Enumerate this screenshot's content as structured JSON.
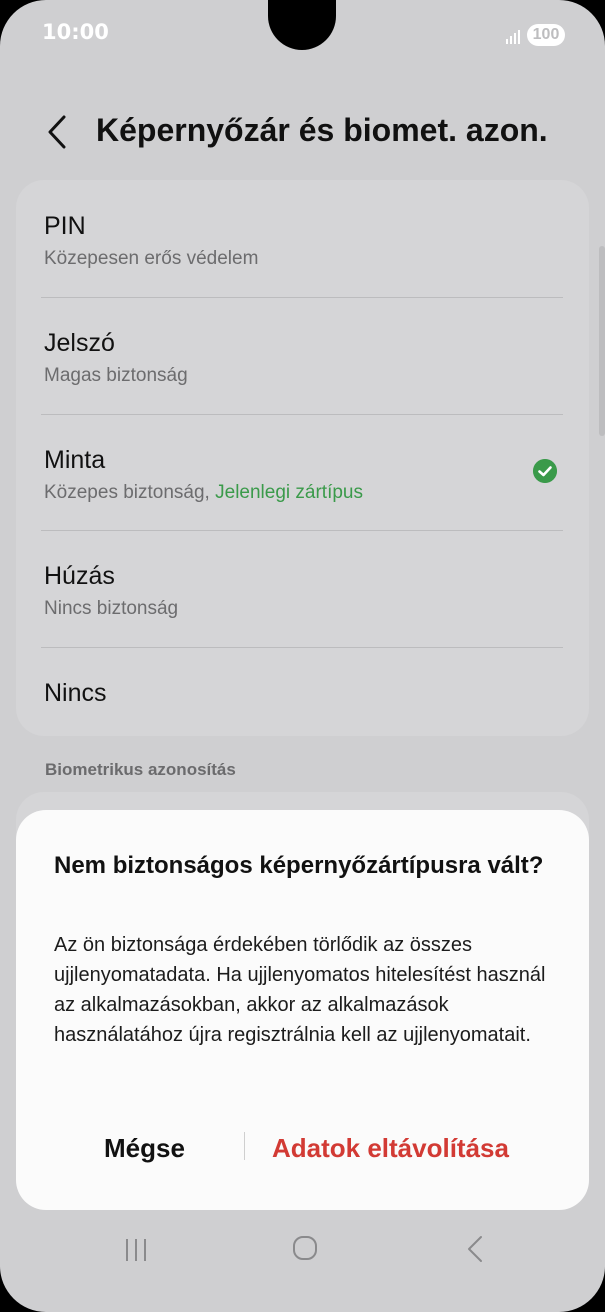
{
  "status_bar": {
    "time": "10:00",
    "battery": "100"
  },
  "header": {
    "title": "Képernyőzár és biomet. azon."
  },
  "lock_types": [
    {
      "label": "PIN",
      "sub": "Közepesen erős védelem"
    },
    {
      "label": "Jelszó",
      "sub": "Magas biztonság"
    },
    {
      "label": "Minta",
      "sub": "Közepes biztonság, ",
      "current": "Jelenlegi zártípus",
      "selected": true
    },
    {
      "label": "Húzás",
      "sub": "Nincs biztonság"
    },
    {
      "label": "Nincs"
    }
  ],
  "section": {
    "biometrics_label": "Biometrikus azonosítás"
  },
  "dialog": {
    "title": "Nem biztonságos képernyőzártípusra vált?",
    "body": "Az ön biztonsága érdekében törlődik az összes ujjlenyomatadata. Ha ujjlenyomatos hitelesítést használ az alkalmazásokban, akkor az alkalmazások használatához újra regisztrálnia kell az ujjlenyomatait.",
    "cancel_label": "Mégse",
    "confirm_label": "Adatok eltávolítása"
  },
  "colors": {
    "accent_green": "#3a9a4a",
    "destructive_red": "#d23a34",
    "dimmed_background": "#cfcfd1"
  },
  "icons": {
    "back": "chevron-left-icon",
    "selected": "check-circle-icon",
    "nav_recent": "recent-apps-icon",
    "nav_home": "home-icon",
    "nav_back": "nav-back-icon"
  }
}
